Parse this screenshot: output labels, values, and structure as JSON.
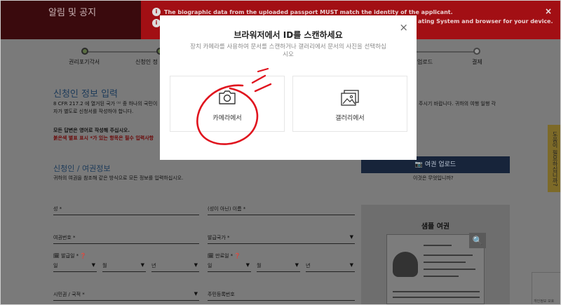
{
  "header": {
    "title": "알림 및 공지",
    "notice_line1": "The biographic data from the uploaded passport MUST match the identity of the applicant.",
    "notice_line2_tail": "ating System and browser for your device.",
    "close_glyph": "×"
  },
  "progress": {
    "steps": [
      "권리포기각서",
      "신청인 정",
      "업로드",
      "결제"
    ],
    "current_step": 1
  },
  "form": {
    "title": "신청인 정보 입력",
    "intro_line1": "8 CFR 217.2 에 열거된 국가 ⁽¹⁾ 중 하나의 국민이",
    "intro_line2": "자가 별도로 신청서를 작성하야 합니다.",
    "intro_right": "주시기 바랍니다. 귀하의 여행 일행 각",
    "english_note": "모든 답변은 영어로 작성해 주십시오.",
    "required_note": "붉은색 별표 표시 *가 있는 항목은 필수 입력사항",
    "section_title": "신청인 / 여권정보",
    "section_hint": "귀하의 여권을 참조해 같은 방식으로 모든 정보를 입력하십시오.",
    "fields": {
      "surname": "성 *",
      "given_name": "(성이 아닌) 이름 *",
      "passport_number": "여권번호 *",
      "issuing_country": "발급국가 *",
      "issue_date": "발급일 *",
      "expiry_date": "만료일 *",
      "day": "일",
      "month": "월",
      "year": "년",
      "citizenship": "시민권 / 국적 *",
      "national_id": "주민등록번호"
    },
    "upload_button": "여권 업로드",
    "what_is_this": "이것은 무엇입니까?",
    "sample_title": "샘플 여권",
    "side_tab": "도움이 필요하십니까?",
    "recaptcha_label": "개인정보 보호"
  },
  "modal": {
    "title": "브라워저에서 ID를 스캔하세요",
    "subtitle": "장치 카메라를 사용하여 문서를 스캔하거나 갤러리에서 문서의 사진을 선택하십시오",
    "camera_label": "카메라에서",
    "gallery_label": "갤러리에서",
    "close_glyph": "×"
  },
  "colors": {
    "notice_red": "#a20f14",
    "upload_navy": "#17243a",
    "highlight_red": "#e0141e"
  },
  "icons": [
    "info-icon",
    "close-icon",
    "camera-icon",
    "gallery-icon",
    "calendar-icon",
    "help-icon",
    "search-icon",
    "chevron-down-icon"
  ]
}
